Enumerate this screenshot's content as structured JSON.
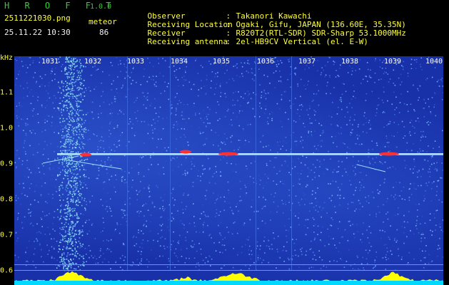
{
  "header": {
    "app_title": "H R O F F T",
    "app_version": "1.0.0",
    "file_name": "2511221030.png",
    "timestamp": "25.11.22 10:30",
    "meteor_label": "meteor",
    "meteor_count": "86"
  },
  "info": [
    {
      "key": "Observer",
      "sep": ":",
      "value": "Takanori Kawachi"
    },
    {
      "key": "Receiving Location",
      "sep": ":",
      "value": "Ogaki, Gifu, JAPAN (136.60E, 35.35N)"
    },
    {
      "key": "Receiver",
      "sep": ":",
      "value": "R820T2(RTL-SDR) SDR-Sharp 53.1000MHz"
    },
    {
      "key": "Receiving antenna",
      "sep": ":",
      "value": "2el-HB9CV Vertical (el. E-W)"
    }
  ],
  "spectrogram": {
    "y_unit": "kHz",
    "x_ticks": [
      "1031",
      "1032",
      "1033",
      "1034",
      "1035",
      "1036",
      "1037",
      "1038",
      "1039",
      "1040"
    ],
    "y_ticks": [
      "1.1",
      "1.0",
      "0.9",
      "0.8",
      "0.7",
      "0.6"
    ],
    "colors": {
      "background": "#1830a8",
      "noise": "#4a78e8",
      "signal": "#ff3030",
      "baseline_fill": "#ffff00",
      "carrier": "#b0e8ff"
    }
  }
}
